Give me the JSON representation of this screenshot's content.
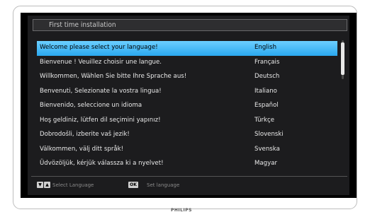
{
  "header": {
    "title": "First time installation"
  },
  "languages": [
    {
      "text": "Welcome please select your language!",
      "lang": "English"
    },
    {
      "text": "Bienvenue ! Veuillez choisir une langue.",
      "lang": "Français"
    },
    {
      "text": "Willkommen, Wählen Sie bitte Ihre Sprache aus!",
      "lang": "Deutsch"
    },
    {
      "text": "Benvenuti, Selezionate la vostra lingua!",
      "lang": "Italiano"
    },
    {
      "text": "Bienvenido, seleccione un idioma",
      "lang": "Español"
    },
    {
      "text": "Hoş geldiniz, lütfen dil seçimini yapınız!",
      "lang": "Türkçe"
    },
    {
      "text": "Dobrodošli, izberite vaš jezik!",
      "lang": "Slovenski"
    },
    {
      "text": "Välkommen, välj ditt språk!",
      "lang": "Svenska"
    },
    {
      "text": "Üdvözöljük, kérjük válassza ki a nyelvet!",
      "lang": "Magyar"
    }
  ],
  "selected_index": 0,
  "footer": {
    "select_hint": "Select Language",
    "ok_key": "OK",
    "set_hint": "Set language"
  },
  "brand": "PHILIPS",
  "colors": {
    "highlight": "#3ab4f5",
    "panel": "#1c1c1e"
  }
}
